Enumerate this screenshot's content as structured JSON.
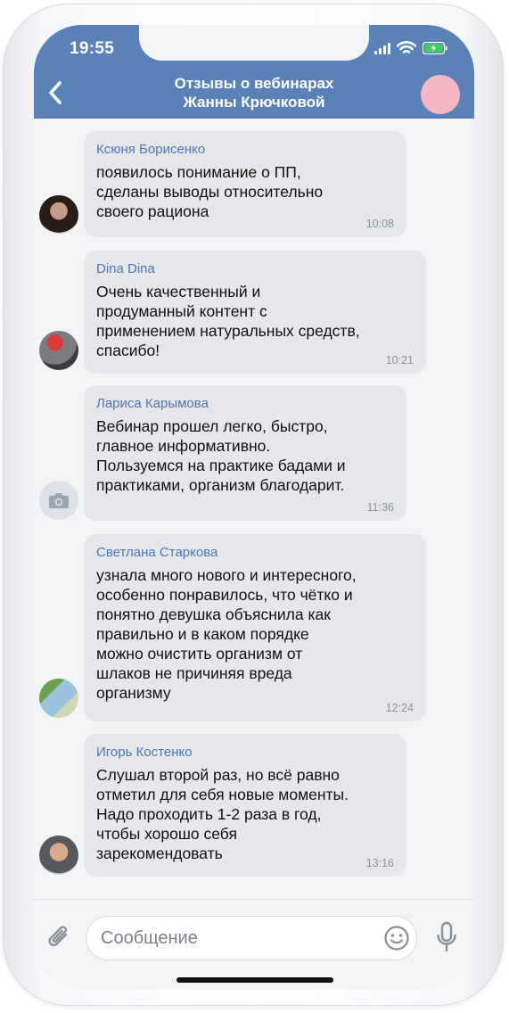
{
  "status_bar": {
    "time": "19:55"
  },
  "header": {
    "title_line1": "Отзывы о вебинарах",
    "title_line2": "Жанны Крючковой",
    "accent": "#5a82b8"
  },
  "messages": [
    {
      "sender": "Ксюня Борисенко",
      "text": "появилось понимание о ПП,\nсделаны выводы относительно\nсвоего рациона",
      "time": "10:08"
    },
    {
      "sender": "Dina Dina",
      "text": "Очень качественный и\nпродуманный контент с\nприменением натуральных средств,\nспасибо!",
      "time": "10:21"
    },
    {
      "sender": "Лариса Карымова",
      "text": "Вебинар прошел легко, быстро,\nглавное информативно.\nПользуемся на практике бадами и\nпрактиками, организм благодарит.",
      "time": "11:36"
    },
    {
      "sender": "Светлана Старкова",
      "text": "узнала много нового и интересного,\nособенно понравилось, что чётко и\nпонятно девушка объяснила как\nправильно и в каком порядке\nможно очистить организм от\nшлаков не причиняя вреда\nорганизму",
      "time": "12:24"
    },
    {
      "sender": "Игорь Костенко",
      "text": "Слушал второй раз, но всё равно\nотметил для себя новые моменты.\nНадо проходить 1-2 раза в год,\nчтобы хорошо себя\nзарекомендовать",
      "time": "13:16"
    }
  ],
  "composer": {
    "placeholder": "Сообщение",
    "value": ""
  },
  "icons": {
    "back": "chevron-left-icon",
    "attach": "paperclip-icon",
    "emoji": "smile-icon",
    "mic": "microphone-icon",
    "camera": "camera-icon"
  }
}
